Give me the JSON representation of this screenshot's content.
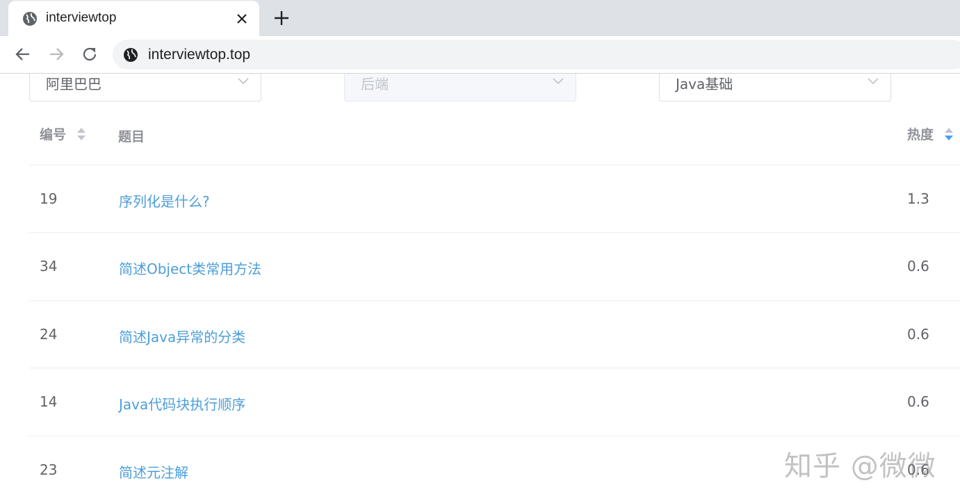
{
  "browser": {
    "tab_title": "interviewtop",
    "url": "interviewtop.top"
  },
  "filters": {
    "company": "阿里巴巴",
    "category": "后端",
    "topic": "Java基础"
  },
  "table": {
    "headers": {
      "id": "编号",
      "question": "题目",
      "heat": "热度"
    },
    "rows": [
      {
        "id": "19",
        "question": "序列化是什么?",
        "heat": "1.3"
      },
      {
        "id": "34",
        "question": "简述Object类常用方法",
        "heat": "0.6"
      },
      {
        "id": "24",
        "question": "简述Java异常的分类",
        "heat": "0.6"
      },
      {
        "id": "14",
        "question": "Java代码块执行顺序",
        "heat": "0.6"
      },
      {
        "id": "23",
        "question": "简述元注解",
        "heat": "0.6"
      }
    ]
  },
  "watermark": "知乎 @微微",
  "colors": {
    "link": "#4c9ed9",
    "sort_active": "#409eff",
    "header_text": "#909399"
  }
}
